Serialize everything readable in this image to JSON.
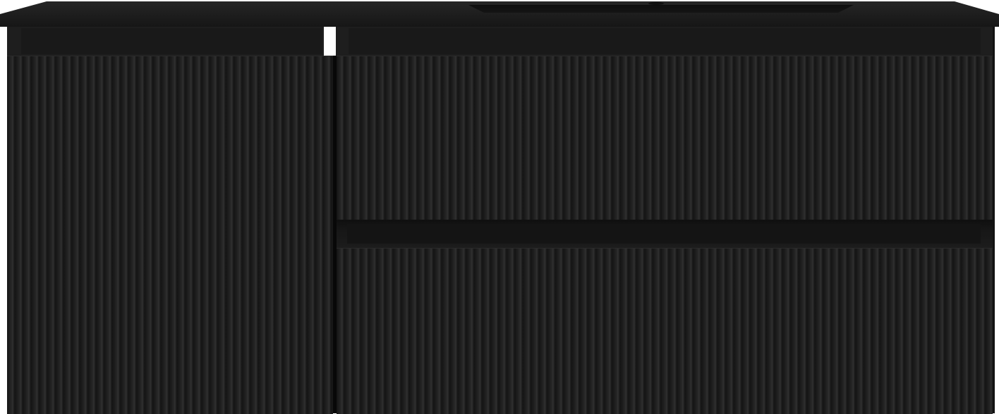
{
  "scene": {
    "subject": "black-fluted-bathroom-vanity",
    "colors": {
      "background": "#ffffff",
      "cabinet": "#1b1b1b",
      "countertop": "#1d1d1d",
      "basin": "#121212"
    }
  }
}
